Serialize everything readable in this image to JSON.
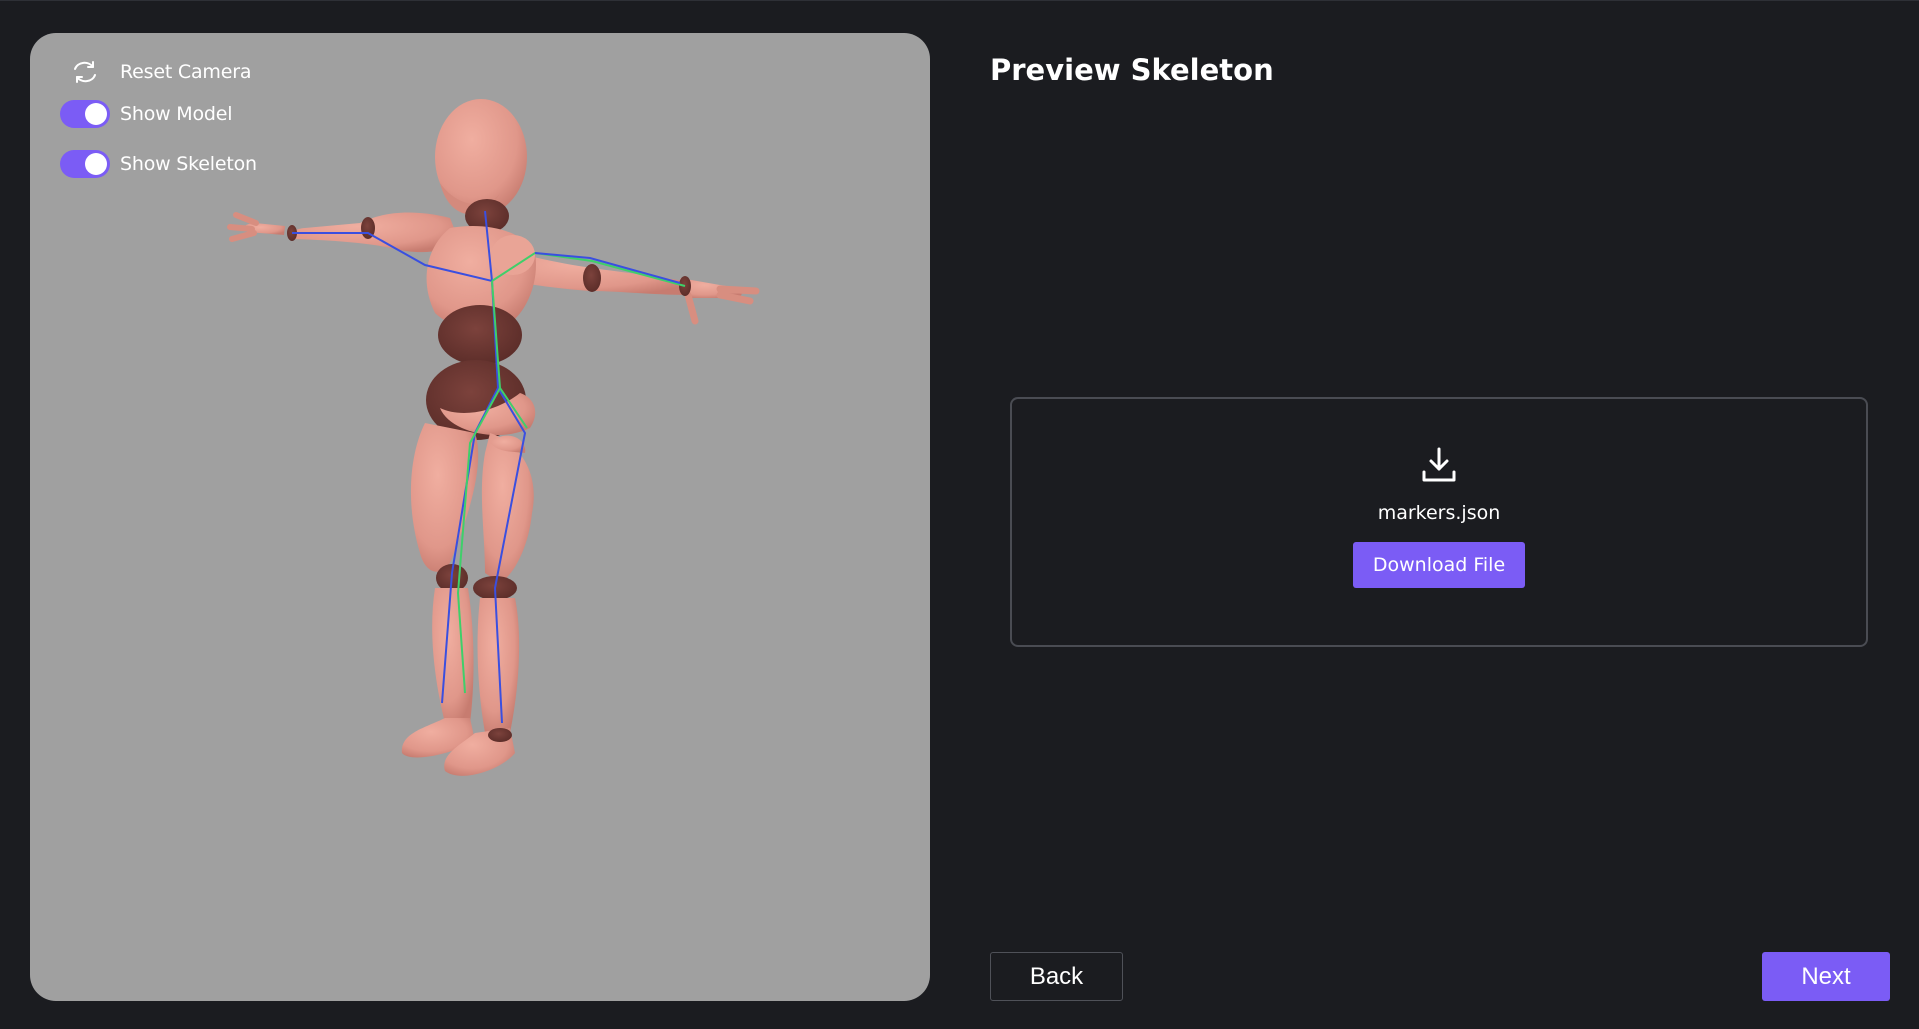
{
  "viewer": {
    "reset_camera_label": "Reset Camera",
    "show_model_label": "Show Model",
    "show_model_on": true,
    "show_skeleton_label": "Show Skeleton",
    "show_skeleton_on": true
  },
  "page": {
    "title": "Preview Skeleton"
  },
  "download": {
    "file_name": "markers.json",
    "button_label": "Download File"
  },
  "nav": {
    "back_label": "Back",
    "next_label": "Next"
  },
  "colors": {
    "accent": "#7b5cf5",
    "background": "#1b1c20",
    "viewport": "#a0a0a0",
    "model_skin": "#e49a8d",
    "model_joint": "#6a3631",
    "bone_blue": "#3a4fe0",
    "bone_green": "#3fcf6a"
  },
  "icons": {
    "reset": "refresh-icon",
    "download": "download-icon"
  }
}
